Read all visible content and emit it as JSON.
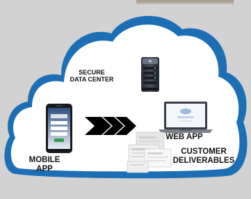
{
  "diagram": {
    "nodes": {
      "data_center": {
        "line1": "SECURE",
        "line2": "DATA CENTER",
        "icon": "server-rack-icon"
      },
      "web_app": {
        "label": "WEB APP",
        "icon": "laptop-icon"
      },
      "mobile_app": {
        "line1": "MOBILE",
        "line2": "APP",
        "icon": "smartphone-icon"
      },
      "customer_deliverables": {
        "line1": "CUSTOMER",
        "line2": "DELIVERABLES",
        "icon": "document-stack-icon"
      }
    },
    "connector": {
      "icon": "triple-chevron-arrow-icon"
    }
  },
  "colors": {
    "background": "#d2d2d2",
    "cloud_border": "#1d6fb5",
    "cloud_fill": "#ffffff",
    "text": "#111111",
    "arrow": "#000000"
  }
}
